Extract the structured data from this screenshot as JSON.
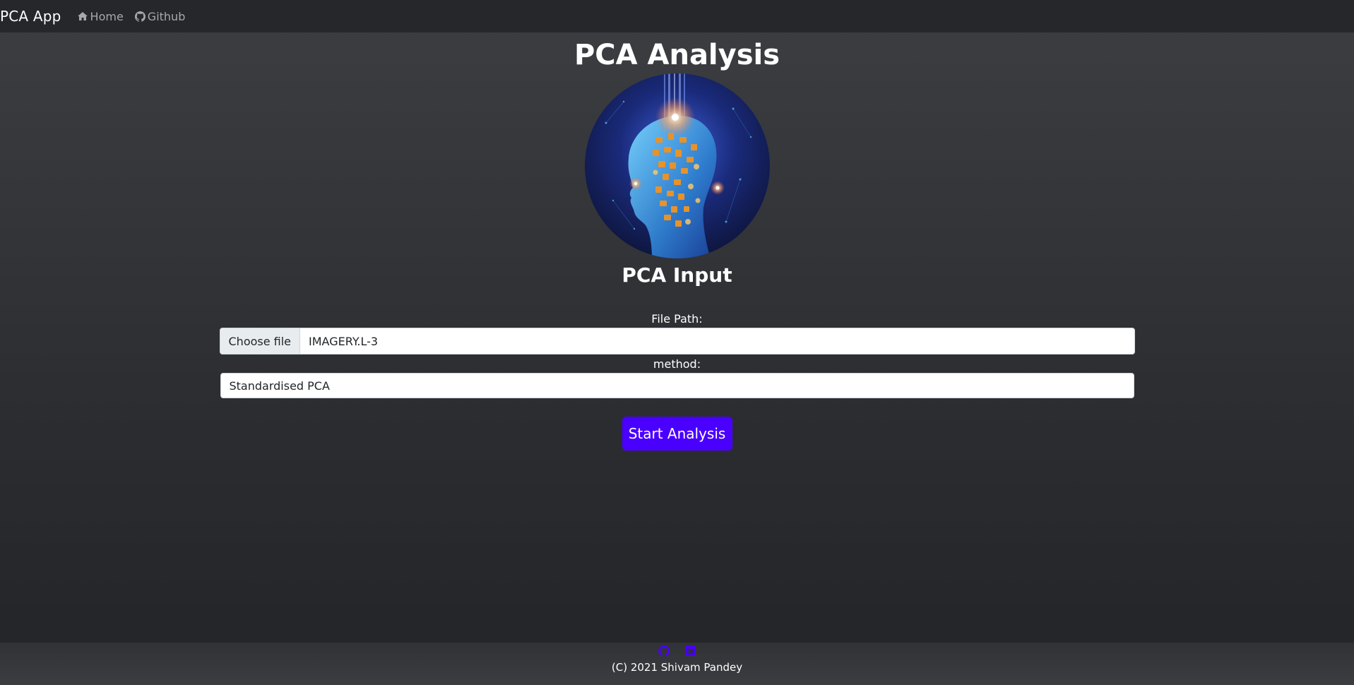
{
  "navbar": {
    "brand": "PCA App",
    "links": [
      {
        "label": "Home",
        "icon": "home-icon"
      },
      {
        "label": "Github",
        "icon": "github-icon"
      }
    ]
  },
  "main": {
    "title": "PCA Analysis",
    "hero_image": "head-network-illustration",
    "section_title": "PCA Input",
    "form": {
      "file_label": "File Path:",
      "file_button": "Choose file",
      "file_name": "IMAGERY.L-3",
      "method_label": "method:",
      "method_value": "Standardised PCA",
      "submit_label": "Start Analysis"
    }
  },
  "footer": {
    "icons": [
      "github-icon",
      "linkedin-icon"
    ],
    "copyright": "(C) 2021 Shivam Pandey"
  },
  "colors": {
    "accent": "#4a00ff",
    "navbar_bg": "#25272b",
    "page_bg": "#34363a"
  }
}
